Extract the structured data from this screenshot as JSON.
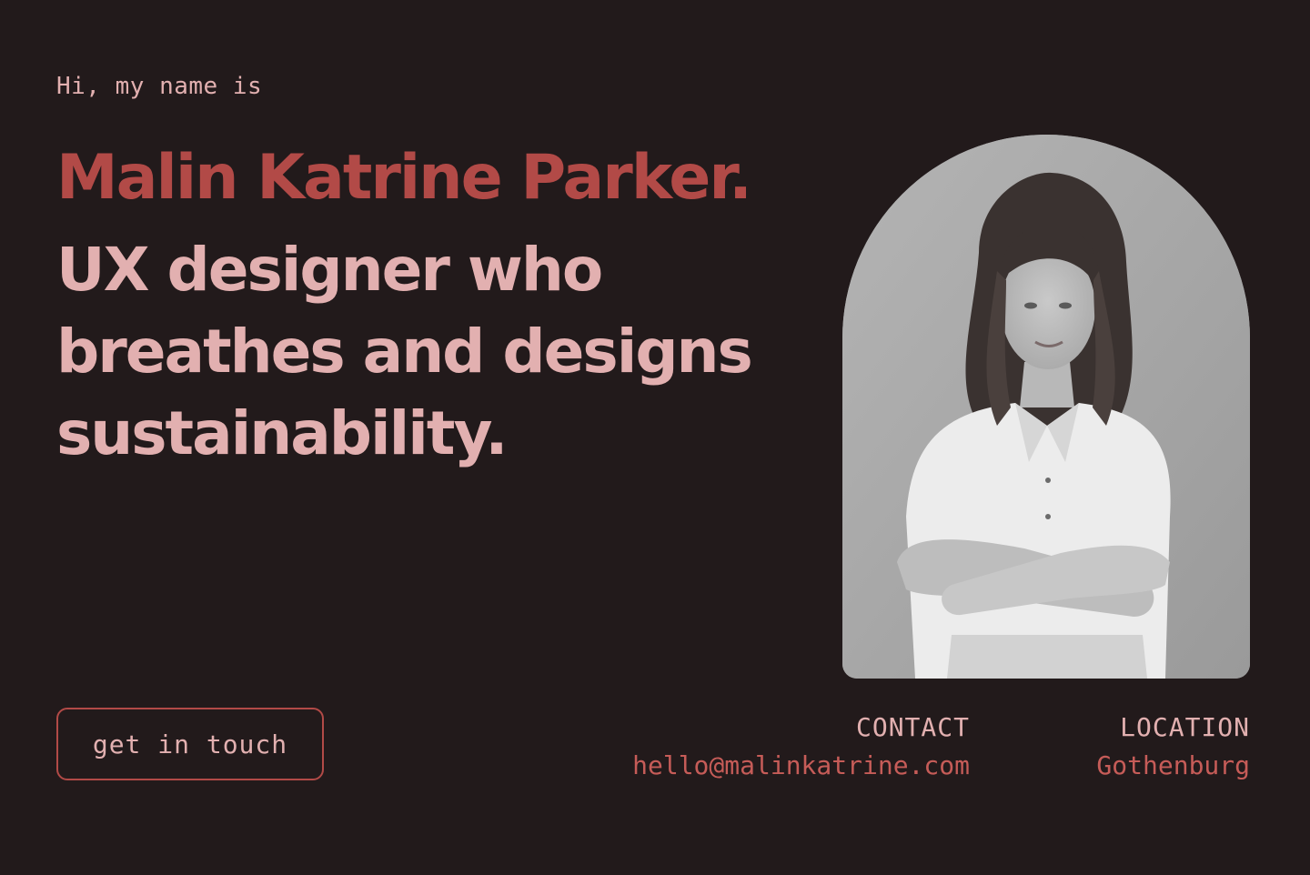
{
  "hero": {
    "greeting": "Hi, my name is",
    "name": "Malin Katrine Parker.",
    "tagline_lines": [
      "UX designer who",
      "breathes and designs",
      "sustainability."
    ]
  },
  "cta": {
    "label": "get in touch"
  },
  "contact": {
    "label": "CONTACT",
    "value": "hello@malinkatrine.com"
  },
  "location": {
    "label": "LOCATION",
    "value": "Gothenburg"
  },
  "colors": {
    "background": "#221a1b",
    "accent": "#b24a47",
    "pink": "#e2b0b0",
    "link": "#c65c58"
  }
}
